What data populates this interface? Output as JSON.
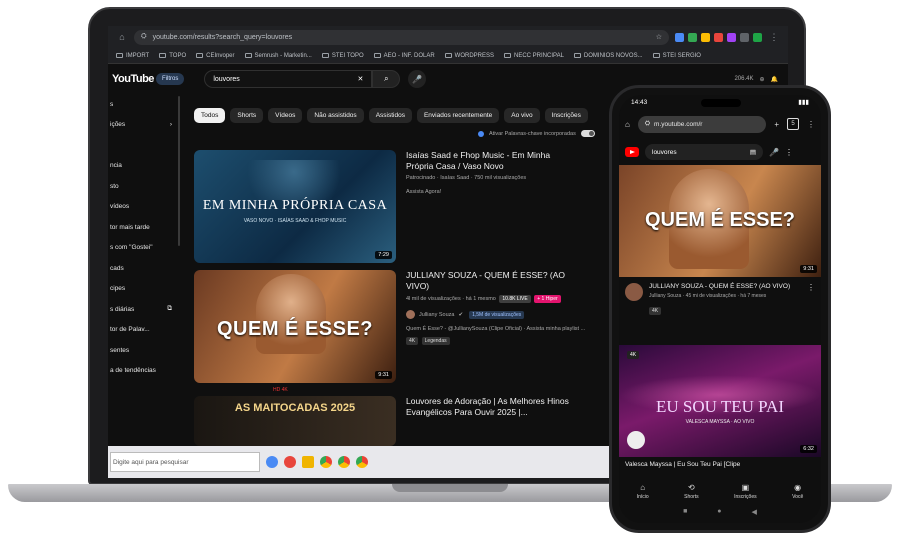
{
  "browser": {
    "url": "youtube.com/results?search_query=louvores",
    "bookmarks": [
      "IMPORT",
      "TOPO",
      "CEInvoper",
      "Semrush - Marketin...",
      "STEI TOPO",
      "AEO - INF. DOLAR",
      "WORDPRESS",
      "NECC PRINCIPAL",
      "DOMINIOS NOVOS...",
      "STEI SERGIO"
    ]
  },
  "yt_desktop": {
    "logo": "YouTube",
    "premium_chip": "Filtros",
    "search_value": "louvores",
    "header_stats": "206.4K",
    "chips": [
      "Todos",
      "Shorts",
      "Vídeos",
      "Não assistidos",
      "Assistidos",
      "Enviados recentemente",
      "Ao vivo",
      "Inscrições"
    ],
    "toggle_label": "Ativar Palavras-chave incorporadas",
    "sidebar": [
      {
        "label": "s",
        "extra": ""
      },
      {
        "label": "ições",
        "extra": "›"
      },
      {
        "label": "",
        "extra": ""
      },
      {
        "label": "ncia",
        "extra": ""
      },
      {
        "label": "sto",
        "extra": ""
      },
      {
        "label": "vídeos",
        "extra": ""
      },
      {
        "label": "tor mais tarde",
        "extra": ""
      },
      {
        "label": "s com \"Gostei\"",
        "extra": ""
      },
      {
        "label": "cads",
        "extra": ""
      },
      {
        "label": "cipes",
        "extra": ""
      },
      {
        "label": "s diárias",
        "extra": "⧉"
      },
      {
        "label": "tor de Palav...",
        "extra": ""
      },
      {
        "label": "sentes",
        "extra": ""
      },
      {
        "label": "a de tendências",
        "extra": ""
      }
    ],
    "results": [
      {
        "title": "Isaías Saad e Fhop Music - Em Minha Própria Casa / Vaso Novo",
        "sub": "Patrocinado · Isaías Saad · 750 mil visualizações",
        "sub2": "Assista Agora!",
        "duration": "7:29",
        "thumb_text": "EM MINHA PRÓPRIA CASA",
        "thumb_sub": "VASO NOVO · ISAÍAS SAAD & FHOP MUSIC"
      },
      {
        "title": "JULLIANY SOUZA - QUEM É ESSE? (AO VIVO)",
        "sub": "4l mil de visualizações · há 1 mesmo",
        "badge1": "10.8K LIVE",
        "badge2": "+ 1 Hiper",
        "channel": "Julliany Souza",
        "channel_badge": "1,5M de visualizações",
        "desc": "Quem É Esse? - @JullianySouza (Clipe Oficial) · Assista minha playlist ...",
        "tag1": "4K",
        "tag2": "Legendas",
        "duration": "9:31",
        "thumb_text": "QUEM É ESSE?",
        "below_thumb": "HD 4K"
      },
      {
        "title": "Louvores de Adoração | As Melhores Hinos Evangélicos Para Ouvir 2025 |...",
        "thumb_text": "AS MAITOCADAS 2025"
      }
    ],
    "taskbar_search": "Digite aqui para pesquisar"
  },
  "phone": {
    "time": "14:43",
    "url": "m.youtube.com/r",
    "tab_count": "5",
    "search_value": "louvores",
    "video1": {
      "thumb_text": "QUEM É ESSE?",
      "duration": "9:31",
      "title": "JULLIANY SOUZA - QUEM É ESSE? (AO VIVO)",
      "sub": "Julliany Souza · 45 mi de visualizações · há 7 meses",
      "tag": "4K"
    },
    "video2": {
      "badge": "4K",
      "thumb_text": "EU SOU TEU PAI",
      "thumb_sub": "VALESCA MAYSSA · AO VIVO",
      "duration": "6:32",
      "title": "Valesca Mayssa | Eu Sou Teu Pai [Clipe"
    },
    "nav": [
      "Início",
      "Shorts",
      "Inscrições",
      "Você"
    ]
  },
  "colors": {
    "yt_red": "#ff0000",
    "bg_dark": "#0f0f0f",
    "chip": "#272727"
  }
}
